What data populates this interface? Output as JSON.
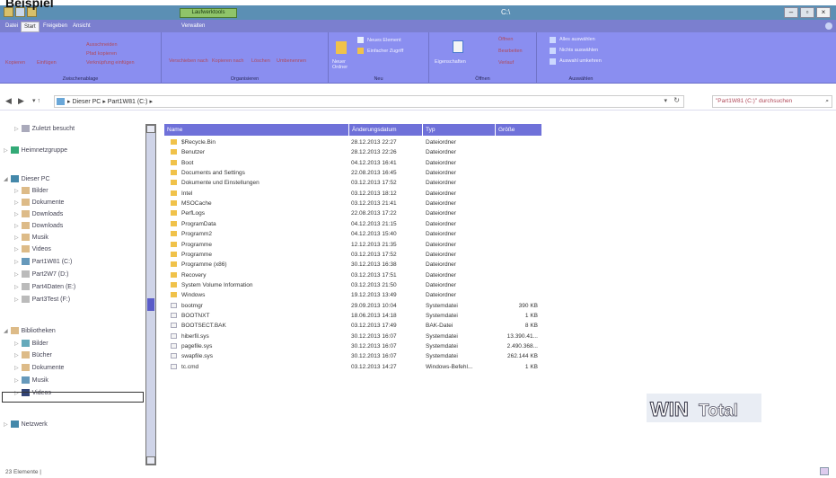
{
  "heading": "Beispiel",
  "window": {
    "ribbon_context": "Laufwerktools",
    "title": "C:\\",
    "min": "–",
    "max": "▫",
    "close": "×"
  },
  "tabs": [
    "Datei",
    "Start",
    "Freigeben",
    "Ansicht",
    "Verwalten"
  ],
  "ribbon": {
    "clipboard": {
      "copy": "Kopieren",
      "paste": "Einfügen",
      "cut": "Ausschneiden",
      "copy_path": "Pfad kopieren",
      "paste_link": "Verknüpfung einfügen",
      "name": "Zwischenablage"
    },
    "organize": {
      "move": "Verschieben nach",
      "copy_to": "Kopieren nach",
      "delete": "Löschen",
      "rename": "Umbenennen",
      "name": "Organisieren"
    },
    "new": {
      "new_folder": "Neuer Ordner",
      "new_item": "Neues Element",
      "easy_access": "Einfacher Zugriff",
      "name": "Neu"
    },
    "open": {
      "properties": "Eigenschaften",
      "open": "Öffnen",
      "edit": "Bearbeiten",
      "history": "Verlauf",
      "name": "Öffnen"
    },
    "select": {
      "all": "Alles auswählen",
      "none": "Nichts auswählen",
      "invert": "Auswahl umkehren",
      "name": "Auswählen"
    }
  },
  "address": {
    "back": "◀",
    "forward": "▶",
    "path": [
      "Dieser PC",
      "Part1W81 (C:)"
    ],
    "search_placeholder": "\"Part1W81 (C:)\" durchsuchen"
  },
  "nav": [
    {
      "label": "Zuletzt besucht",
      "indent": 1,
      "icon": "recent-icon",
      "color": "#aab"
    },
    {
      "label": "Heimnetzgruppe",
      "indent": 0,
      "icon": "homegroup-icon",
      "color": "#3a7"
    },
    {
      "label": "Dieser PC",
      "indent": 0,
      "icon": "pc-icon",
      "color": "#48a",
      "open": true
    },
    {
      "label": "Bilder",
      "indent": 1,
      "icon": "pictures-icon",
      "color": "#db8"
    },
    {
      "label": "Dokumente",
      "indent": 1,
      "icon": "documents-icon",
      "color": "#db8"
    },
    {
      "label": "Downloads",
      "indent": 1,
      "icon": "downloads-icon",
      "color": "#db8"
    },
    {
      "label": "Downloads",
      "indent": 1,
      "icon": "downloads-icon",
      "color": "#db8"
    },
    {
      "label": "Musik",
      "indent": 1,
      "icon": "music-icon",
      "color": "#db8"
    },
    {
      "label": "Videos",
      "indent": 1,
      "icon": "videos-icon",
      "color": "#db8"
    },
    {
      "label": "Part1W81 (C:)",
      "indent": 1,
      "icon": "drive-icon",
      "color": "#69b"
    },
    {
      "label": "Part2W7 (D:)",
      "indent": 1,
      "icon": "drive-icon",
      "color": "#bbb"
    },
    {
      "label": "Part4Daten (E:)",
      "indent": 1,
      "icon": "drive-icon",
      "color": "#bbb"
    },
    {
      "label": "Part3Test (F:)",
      "indent": 1,
      "icon": "drive-icon",
      "color": "#bbb"
    },
    {
      "label": "Bibliotheken",
      "indent": 0,
      "icon": "libraries-icon",
      "color": "#db8",
      "open": true
    },
    {
      "label": "Bilder",
      "indent": 1,
      "icon": "pictures-icon",
      "color": "#6ab"
    },
    {
      "label": "Bücher",
      "indent": 1,
      "icon": "books-icon",
      "color": "#db8"
    },
    {
      "label": "Dokumente",
      "indent": 1,
      "icon": "documents-icon",
      "color": "#db8"
    },
    {
      "label": "Musik",
      "indent": 1,
      "icon": "music-icon",
      "color": "#69b"
    },
    {
      "label": "Videos",
      "indent": 1,
      "icon": "videos-icon",
      "color": "#347"
    },
    {
      "label": "Netzwerk",
      "indent": 0,
      "icon": "network-icon",
      "color": "#48a"
    }
  ],
  "columns": [
    "Name",
    "Änderungsdatum",
    "Typ",
    "Größe"
  ],
  "files": [
    {
      "name": "$Recycle.Bin",
      "date": "28.12.2013 22:27",
      "type": "Dateiordner",
      "size": "",
      "folder": true
    },
    {
      "name": "Benutzer",
      "date": "28.12.2013 22:26",
      "type": "Dateiordner",
      "size": "",
      "folder": true
    },
    {
      "name": "Boot",
      "date": "04.12.2013 16:41",
      "type": "Dateiordner",
      "size": "",
      "folder": true
    },
    {
      "name": "Documents and Settings",
      "date": "22.08.2013 16:45",
      "type": "Dateiordner",
      "size": "",
      "folder": true
    },
    {
      "name": "Dokumente und Einstellungen",
      "date": "03.12.2013 17:52",
      "type": "Dateiordner",
      "size": "",
      "folder": true
    },
    {
      "name": "Intel",
      "date": "03.12.2013 18:12",
      "type": "Dateiordner",
      "size": "",
      "folder": true
    },
    {
      "name": "MSOCache",
      "date": "03.12.2013 21:41",
      "type": "Dateiordner",
      "size": "",
      "folder": true
    },
    {
      "name": "PerfLogs",
      "date": "22.08.2013 17:22",
      "type": "Dateiordner",
      "size": "",
      "folder": true
    },
    {
      "name": "ProgramData",
      "date": "04.12.2013 21:15",
      "type": "Dateiordner",
      "size": "",
      "folder": true
    },
    {
      "name": "Programm2",
      "date": "04.12.2013 15:40",
      "type": "Dateiordner",
      "size": "",
      "folder": true
    },
    {
      "name": "Programme",
      "date": "12.12.2013 21:35",
      "type": "Dateiordner",
      "size": "",
      "folder": true
    },
    {
      "name": "Programme",
      "date": "03.12.2013 17:52",
      "type": "Dateiordner",
      "size": "",
      "folder": true
    },
    {
      "name": "Programme (x86)",
      "date": "30.12.2013 16:38",
      "type": "Dateiordner",
      "size": "",
      "folder": true
    },
    {
      "name": "Recovery",
      "date": "03.12.2013 17:51",
      "type": "Dateiordner",
      "size": "",
      "folder": true
    },
    {
      "name": "System Volume Information",
      "date": "03.12.2013 21:50",
      "type": "Dateiordner",
      "size": "",
      "folder": true
    },
    {
      "name": "Windows",
      "date": "19.12.2013 13:49",
      "type": "Dateiordner",
      "size": "",
      "folder": true
    },
    {
      "name": "bootmgr",
      "date": "29.09.2013 10:04",
      "type": "Systemdatei",
      "size": "390 KB",
      "folder": false
    },
    {
      "name": "BOOTNXT",
      "date": "18.06.2013 14:18",
      "type": "Systemdatei",
      "size": "1 KB",
      "folder": false
    },
    {
      "name": "BOOTSECT.BAK",
      "date": "03.12.2013 17:49",
      "type": "BAK-Datei",
      "size": "8 KB",
      "folder": false
    },
    {
      "name": "hiberfil.sys",
      "date": "30.12.2013 16:07",
      "type": "Systemdatei",
      "size": "13.390.41...",
      "folder": false
    },
    {
      "name": "pagefile.sys",
      "date": "30.12.2013 16:07",
      "type": "Systemdatei",
      "size": "2.490.368...",
      "folder": false
    },
    {
      "name": "swapfile.sys",
      "date": "30.12.2013 16:07",
      "type": "Systemdatei",
      "size": "262.144 KB",
      "folder": false
    },
    {
      "name": "tc.cmd",
      "date": "03.12.2013 14:27",
      "type": "Windows-Befehl...",
      "size": "1 KB",
      "folder": false
    }
  ],
  "status": "23 Elemente",
  "logo": {
    "a": "WIN",
    "b": "Total"
  },
  "colors": {
    "title": "#5b8fb4",
    "tabs": "#7b7fcf",
    "ribbon": "#8a8ef0",
    "header": "#6f71d9",
    "folder": "#f0c24a",
    "accent_text": "#b14a5a"
  }
}
